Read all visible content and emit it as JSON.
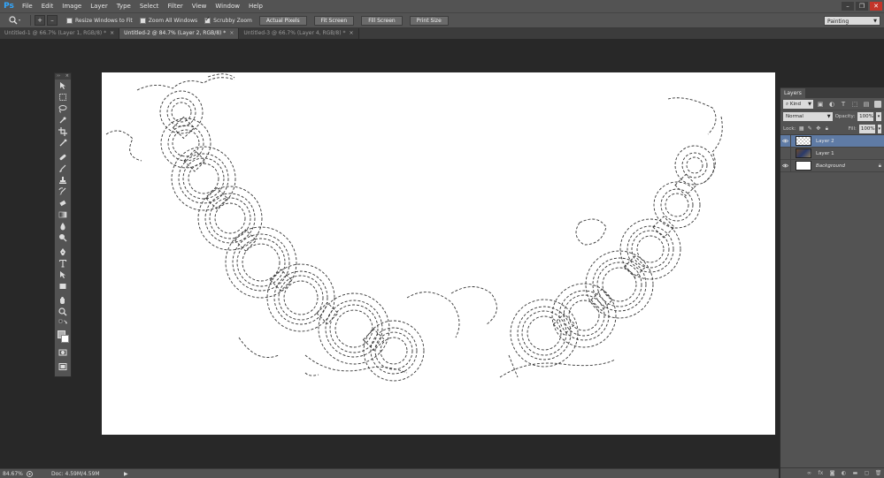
{
  "app": {
    "logo": "Ps"
  },
  "menu": [
    "File",
    "Edit",
    "Image",
    "Layer",
    "Type",
    "Select",
    "Filter",
    "View",
    "Window",
    "Help"
  ],
  "window_controls": {
    "minimize": "–",
    "restore": "❐",
    "close": "✕"
  },
  "options": {
    "tool_icon": "zoom-icon",
    "zoom_in": "+",
    "zoom_out": "–",
    "resize_windows_label": "Resize Windows to Fit",
    "resize_windows_checked": false,
    "zoom_all_label": "Zoom All Windows",
    "zoom_all_checked": false,
    "scrubby_zoom_label": "Scrubby Zoom",
    "scrubby_zoom_checked": true,
    "buttons": [
      "Actual Pixels",
      "Fit Screen",
      "Fill Screen",
      "Print Size"
    ],
    "workspace": "Painting"
  },
  "tabs": [
    {
      "label": "Untitled-1 @ 66.7% (Layer 1, RGB/8) *",
      "active": false
    },
    {
      "label": "Untitled-2 @ 84.7% (Layer 2, RGB/8) *",
      "active": true
    },
    {
      "label": "Untitled-3 @ 66.7% (Layer 4, RGB/8) *",
      "active": false
    }
  ],
  "tab_close": "×",
  "status": {
    "zoom": "84.67%",
    "doc": "Doc: 4.59M/4.59M",
    "arrow": "▶"
  },
  "layers": {
    "panel_title": "Layers",
    "filter_kind": "Kind",
    "blend_mode": "Normal",
    "opacity_label": "Opacity:",
    "opacity_value": "100%",
    "lock_label": "Lock:",
    "fill_label": "Fill:",
    "fill_value": "100%",
    "items": [
      {
        "name": "Layer 2",
        "visible": true,
        "selected": true,
        "thumb": "transparent"
      },
      {
        "name": "Layer 1",
        "visible": false,
        "selected": false,
        "thumb": "image"
      },
      {
        "name": "Background",
        "visible": true,
        "selected": false,
        "thumb": "white",
        "locked": true
      }
    ],
    "footer_icons": [
      "link-icon",
      "fx-icon",
      "mask-icon",
      "adjustment-icon",
      "group-icon",
      "new-layer-icon",
      "trash-icon"
    ]
  },
  "colors": {
    "accent": "#31a8ff",
    "selected_layer": "#5f7ba5",
    "canvas": "#ffffff",
    "workspace_bg": "#282828"
  }
}
